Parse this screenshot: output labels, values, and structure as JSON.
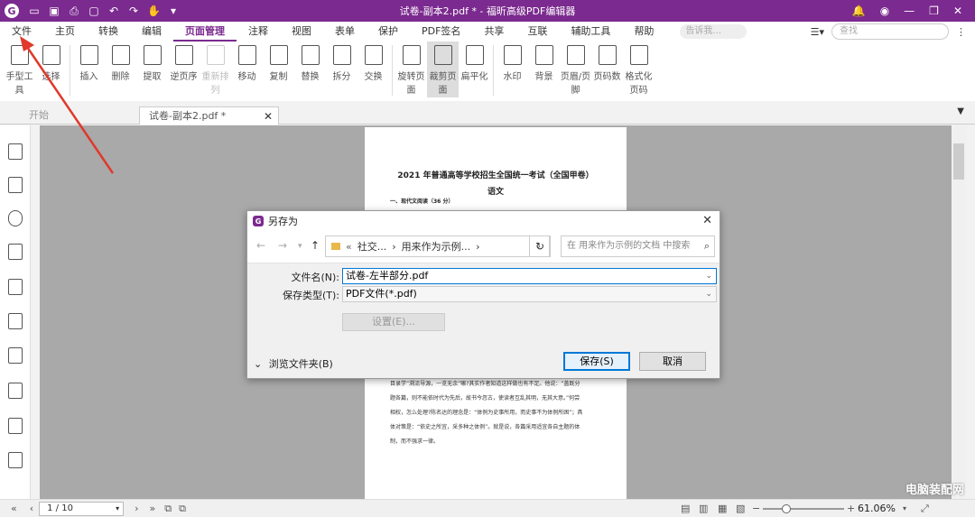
{
  "titlebar": {
    "title": "试卷-副本2.pdf * - 福昕高级PDF编辑器",
    "logo": "G"
  },
  "menu": {
    "items": [
      "文件",
      "主页",
      "转换",
      "编辑",
      "页面管理",
      "注释",
      "视图",
      "表单",
      "保护",
      "PDF签名",
      "共享",
      "互联",
      "辅助工具",
      "帮助"
    ],
    "active": "页面管理",
    "tell_me_placeholder": "告诉我...",
    "search_placeholder": "查找"
  },
  "ribbon": {
    "hand_tool": "手型工具",
    "select": "选择",
    "insert": "插入",
    "delete": "删除",
    "extract": "提取",
    "reverse_pages": "逆页序",
    "reorder": "重新排列",
    "move": "移动",
    "copy": "复制",
    "replace": "替换",
    "split": "拆分",
    "swap": "交换",
    "rotate": "旋转页面",
    "crop": "裁剪页面",
    "flatten": "扁平化",
    "watermark": "水印",
    "background": "背景",
    "header_footer": "页眉/页脚",
    "page_number": "页码数",
    "format_page_number": "格式化页码"
  },
  "tabs": {
    "start": "开始",
    "doc": "试卷-副本2.pdf *"
  },
  "document": {
    "title": "2021 年普通高等学校招生全国统一考试（全国甲卷）",
    "subject": "语文",
    "section": "一、现代文阅读（36 分）",
    "para1": "目录学“溯流导源，一览无余”嘛?其实作者知道这样做也有不足。他说：“盖既分",
    "para2": "题各篇，则不能依时代为先后，故书今忽古，使读者互乱其明，无其大意。”何尝",
    "para3": "相权，怎么处理?陈名达的理念是：“体例为史事所用，而史事不为体例所困”；具",
    "para4": "体对策是：“依史之所宜，采多种之体例”。就是说，各篇采用适宜各自主题的体",
    "para5": "制，而不强求一律。"
  },
  "dialog": {
    "title": "另存为",
    "path_prefix": "«",
    "path_part1": "社交...",
    "path_part2": "用来作为示例...",
    "search_placeholder": "在 用来作为示例的文档 中搜索",
    "filename_label": "文件名(N):",
    "filename_value": "试卷-左半部分.pdf",
    "filetype_label": "保存类型(T):",
    "filetype_value": "PDF文件(*.pdf)",
    "settings_button": "设置(E)...",
    "browse_folders": "浏览文件夹(B)",
    "save_button": "保存(S)",
    "cancel_button": "取消"
  },
  "status": {
    "page_indicator": "1 / 10",
    "zoom": "61.06%"
  },
  "watermark": "电脑装配网",
  "colors": {
    "brand": "#7b2a8f",
    "annotation_arrow": "#e0392b"
  }
}
